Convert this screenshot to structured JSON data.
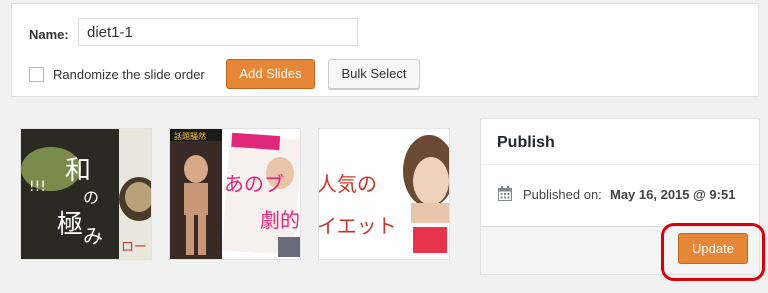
{
  "form": {
    "name_label": "Name:",
    "name_value": "diet1-1",
    "randomize_label": "Randomize the slide order",
    "randomize_checked": false,
    "add_slides_label": "Add Slides",
    "bulk_select_label": "Bulk Select"
  },
  "slides": [
    {
      "subject": "japanese-food-magazine-cover",
      "text": [
        "和",
        "の",
        "極",
        "み",
        "ロー"
      ]
    },
    {
      "subject": "magazine-covers-with-model",
      "text": [
        "あのブ",
        "劇的",
        "話題騒然"
      ]
    },
    {
      "subject": "woman-portrait-diet-ad",
      "text": [
        "人気の",
        "イエット"
      ]
    }
  ],
  "publish": {
    "title": "Publish",
    "published_label": "Published on:",
    "published_value": "May 16, 2015 @ 9:51",
    "update_label": "Update"
  },
  "colors": {
    "accent": "#e58736",
    "highlight": "#d7000f",
    "background": "#f1f1f1"
  },
  "icons": {
    "calendar": "calendar-icon"
  }
}
